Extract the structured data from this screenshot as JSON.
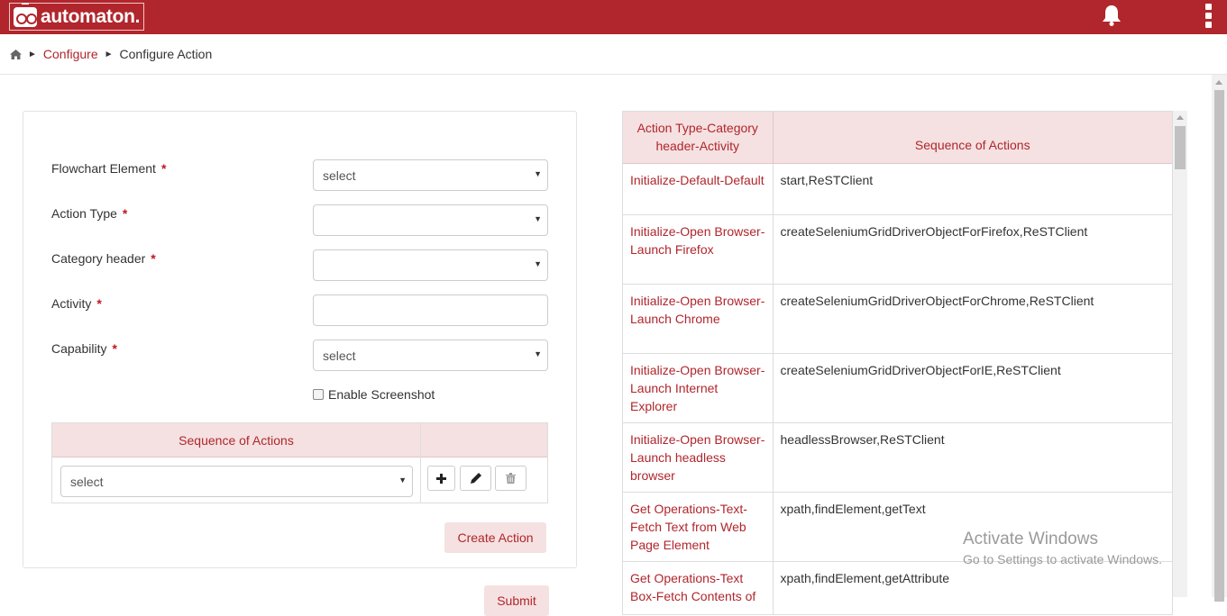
{
  "header": {
    "brand": "automaton.",
    "logo_icon": "robot-logo-icon",
    "notification_icon": "bell-icon",
    "menu_icon": "kebab-menu-icon",
    "accent_color": "#b0262c"
  },
  "breadcrumb": {
    "home_icon": "home-icon",
    "items": [
      "Configure",
      "Configure Action"
    ]
  },
  "form": {
    "fields": [
      {
        "label": "Flowchart Element",
        "required": "*",
        "value": "select",
        "type": "select"
      },
      {
        "label": "Action Type",
        "required": "*",
        "value": "",
        "type": "select"
      },
      {
        "label": "Category header",
        "required": "*",
        "value": "",
        "type": "select"
      },
      {
        "label": "Activity",
        "required": "*",
        "value": "",
        "type": "text"
      },
      {
        "label": "Capability",
        "required": "*",
        "value": "select",
        "type": "select"
      }
    ],
    "enable_screenshot_label": "Enable Screenshot",
    "sequence": {
      "header": "Sequence of Actions",
      "select_value": "select",
      "add_icon": "plus-icon",
      "edit_icon": "pencil-icon",
      "delete_icon": "trash-icon"
    },
    "create_label": "Create Action",
    "submit_label": "Submit"
  },
  "actions_table": {
    "headers": [
      "Action Type-Category header-Activity",
      "Sequence of Actions"
    ],
    "rows": [
      {
        "activity": "Initialize-Default-Default",
        "sequence": "start,ReSTClient"
      },
      {
        "activity": "Initialize-Open Browser-Launch Firefox",
        "sequence": "createSeleniumGridDriverObjectForFirefox,ReSTClient"
      },
      {
        "activity": "Initialize-Open Browser-Launch Chrome",
        "sequence": "createSeleniumGridDriverObjectForChrome,ReSTClient"
      },
      {
        "activity": "Initialize-Open Browser-Launch Internet Explorer",
        "sequence": "createSeleniumGridDriverObjectForIE,ReSTClient"
      },
      {
        "activity": "Initialize-Open Browser-Launch headless browser",
        "sequence": "headlessBrowser,ReSTClient"
      },
      {
        "activity": "Get Operations-Text-Fetch Text from Web Page Element",
        "sequence": "xpath,findElement,getText"
      },
      {
        "activity": "Get Operations-Text Box-Fetch Contents of",
        "sequence": "xpath,findElement,getAttribute"
      }
    ]
  },
  "watermark": {
    "title": "Activate Windows",
    "subtitle": "Go to Settings to activate Windows."
  }
}
